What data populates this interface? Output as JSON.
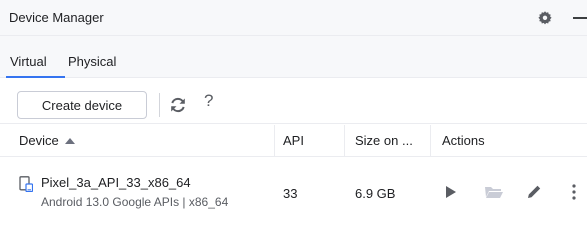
{
  "window": {
    "title": "Device Manager",
    "actions": [
      {
        "name": "gear-icon"
      },
      {
        "name": "minimize-icon"
      }
    ]
  },
  "tabs": [
    {
      "label": "Virtual",
      "selected": true
    },
    {
      "label": "Physical",
      "selected": false
    }
  ],
  "toolbar": {
    "create_label": "Create device",
    "refresh_icon": "refresh-icon",
    "help_label": "?"
  },
  "table": {
    "columns": [
      "Device",
      "API",
      "Size on ...",
      "Actions"
    ],
    "sort_column": "Device",
    "sort_direction": "ascending",
    "rows": [
      {
        "icon": "phone-icon",
        "name": "Pixel_3a_API_33_x86_64",
        "subtitle": "Android 13.0 Google APIs | x86_64",
        "api": "33",
        "size": "6.9 GB",
        "actions": [
          "launch-icon",
          "folder-icon",
          "edit-icon",
          "more-icon"
        ]
      }
    ]
  },
  "colors": {
    "accent": "#3574f0",
    "text": "#1e1f22",
    "secondary_text": "#5a5d63",
    "icon": "#5a5d63",
    "disabled_icon": "#c9ccd6",
    "phone_icon": "#3574f0"
  }
}
